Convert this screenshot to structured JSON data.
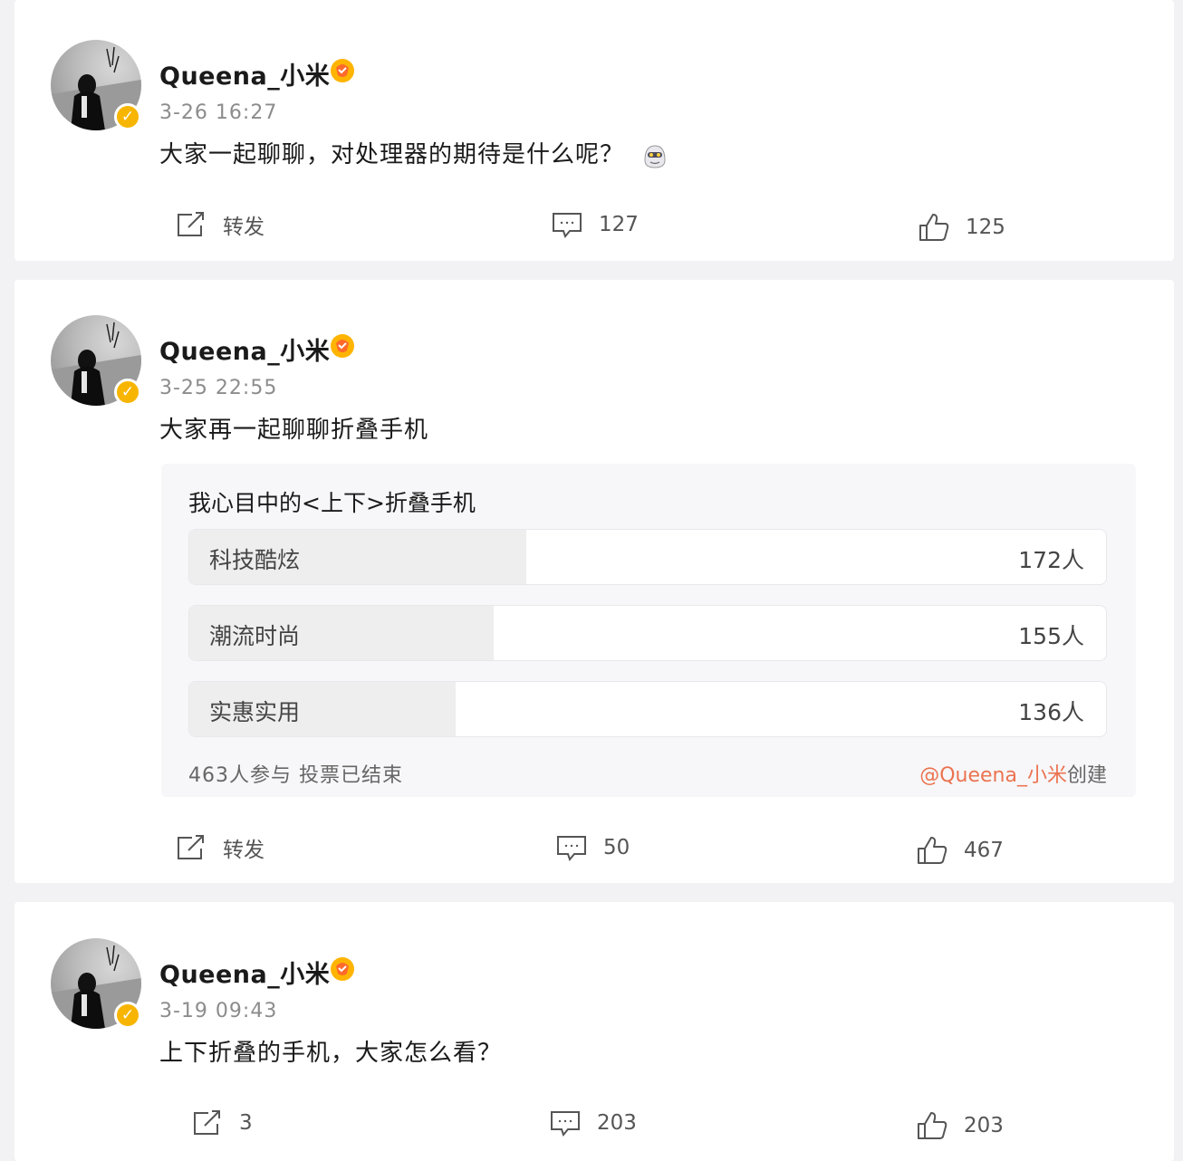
{
  "posts": [
    {
      "name": "Queena_小米",
      "time": "3-26 16:27",
      "text": "大家一起聊聊，对处理器的期待是什么呢？",
      "repost": "转发",
      "comments": "127",
      "likes": "125"
    },
    {
      "name": "Queena_小米",
      "time": "3-25 22:55",
      "text": "大家再一起聊聊折叠手机",
      "poll": {
        "title": "我心目中的<上下>折叠手机",
        "options": [
          {
            "label": "科技酷炫",
            "count": "172人",
            "votes": 172
          },
          {
            "label": "潮流时尚",
            "count": "155人",
            "votes": 155
          },
          {
            "label": "实惠实用",
            "count": "136人",
            "votes": 136
          }
        ],
        "summary": "463人参与 投票已结束",
        "creator": "@Queena_小米",
        "creator_suffix": "创建"
      },
      "repost": "转发",
      "comments": "50",
      "likes": "467"
    },
    {
      "name": "Queena_小米",
      "time": "3-19 09:43",
      "text": "上下折叠的手机，大家怎么看？",
      "repost": "3",
      "comments": "203",
      "likes": "203"
    }
  ],
  "colors": {
    "verified": "#f7b500",
    "creator_link": "#eb7350",
    "poll_fill": "#eeeeef"
  },
  "icons": [
    "avatar",
    "verified-icon",
    "fan-badge-icon",
    "emoji-icon",
    "repost-icon",
    "comment-icon",
    "like-icon"
  ]
}
